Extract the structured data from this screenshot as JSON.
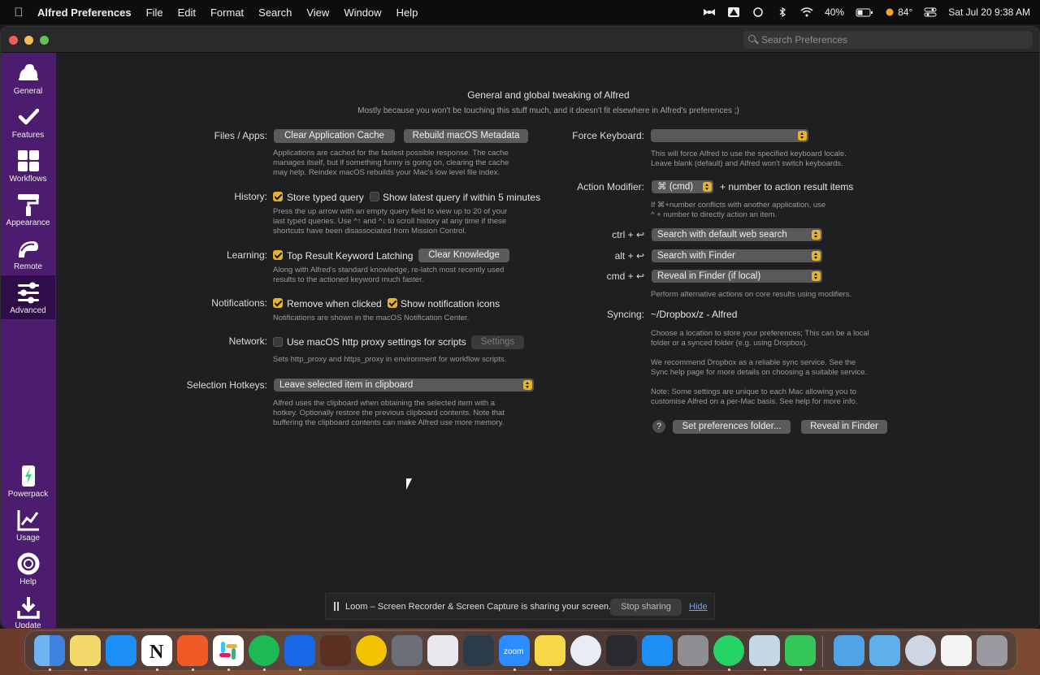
{
  "menubar": {
    "app_name": "Alfred Preferences",
    "items": [
      "File",
      "Edit",
      "Format",
      "Search",
      "View",
      "Window",
      "Help"
    ],
    "battery": "40%",
    "weather": "84°",
    "clock": "Sat Jul 20  9:38 AM"
  },
  "window": {
    "search_placeholder": "Search Preferences"
  },
  "sidebar": {
    "top": [
      {
        "label": "General",
        "icon": "alfred-hat-icon",
        "active": false
      },
      {
        "label": "Features",
        "icon": "checkmark-icon",
        "active": false
      },
      {
        "label": "Workflows",
        "icon": "grid-icon",
        "active": false
      },
      {
        "label": "Appearance",
        "icon": "paint-roller-icon",
        "active": false
      },
      {
        "label": "Remote",
        "icon": "remote-icon",
        "active": false
      },
      {
        "label": "Advanced",
        "icon": "sliders-icon",
        "active": true
      }
    ],
    "bottom": [
      {
        "label": "Powerpack",
        "icon": "powerpack-icon"
      },
      {
        "label": "Usage",
        "icon": "chart-icon"
      },
      {
        "label": "Help",
        "icon": "lifebuoy-icon"
      },
      {
        "label": "Update",
        "icon": "download-icon"
      }
    ]
  },
  "header": {
    "title": "General and global tweaking of Alfred",
    "subtitle": "Mostly because you won't be touching this stuff much, and it doesn't fit elsewhere in Alfred's preferences ;)"
  },
  "left": {
    "files": {
      "label": "Files / Apps:",
      "clear_cache": "Clear Application Cache",
      "rebuild": "Rebuild macOS Metadata",
      "desc": [
        "Applications are cached for the fastest possible response. The cache",
        "manages itself, but if something funny is going on, clearing the cache",
        "may help. Reindex macOS rebuilds your Mac's low level file index."
      ]
    },
    "history": {
      "label": "History:",
      "store": "Store typed query",
      "show_latest": "Show latest query if within 5 minutes",
      "desc": [
        "Press the up arrow with an empty query field to view up to 20 of your",
        "last typed queries. Use ^↑ and ^↓ to scroll history at any time if these",
        "shortcuts have been disassociated from Mission Control."
      ]
    },
    "learning": {
      "label": "Learning:",
      "latching": "Top Result Keyword Latching",
      "clear_knowledge": "Clear Knowledge",
      "desc": [
        "Along with Alfred's standard knowledge, re-latch most recently used",
        "results to the actioned keyword much faster."
      ]
    },
    "notifications": {
      "label": "Notifications:",
      "remove": "Remove when clicked",
      "show_icons": "Show notification icons",
      "desc": "Notifications are shown in the macOS Notification Center."
    },
    "network": {
      "label": "Network:",
      "proxy": "Use macOS http proxy settings for scripts",
      "settings_btn": "Settings",
      "desc": "Sets http_proxy and https_proxy in environment for workflow scripts."
    },
    "hotkeys": {
      "label": "Selection Hotkeys:",
      "value": "Leave selected item in clipboard",
      "desc": [
        "Alfred uses the clipboard when obtaining the selected item with a",
        "hotkey. Optionally restore the previous clipboard contents. Note that",
        "buffering the clipboard contents can make Alfred use more memory."
      ]
    }
  },
  "right": {
    "force_keyboard": {
      "label": "Force Keyboard:",
      "value": "",
      "desc": [
        "This will force Alfred to use the specified keyboard locale.",
        "Leave blank (default) and Alfred won't switch keyboards."
      ]
    },
    "action_modifier": {
      "label": "Action Modifier:",
      "value": "⌘ (cmd)",
      "suffix": "+ number to action result items",
      "desc": [
        "If ⌘+number conflicts with another application, use",
        "^ + number to directly action an item."
      ]
    },
    "modifiers": {
      "ctrl_label": "ctrl + ↩",
      "ctrl_value": "Search with default web search",
      "alt_label": "alt + ↩",
      "alt_value": "Search with Finder",
      "cmd_label": "cmd + ↩",
      "cmd_value": "Reveal in Finder (if local)",
      "desc": "Perform alternative actions on core results using modifiers."
    },
    "syncing": {
      "label": "Syncing:",
      "value": "~/Dropbox/z - Alfred",
      "desc1": [
        "Choose a location to store your preferences; This can be a local",
        "folder or a synced folder (e.g. using Dropbox)."
      ],
      "desc2": [
        "We recommend Dropbox as a reliable sync service. See the",
        "Sync help page for more details on choosing a suitable service."
      ],
      "desc3": [
        "Note: Some settings are unique to each Mac allowing you to",
        "customise Alfred on a per-Mac basis. See help for more info."
      ],
      "help": "?",
      "set_folder": "Set preferences folder...",
      "reveal": "Reveal in Finder"
    }
  },
  "loom": {
    "message": "Loom – Screen Recorder & Screen Capture is sharing your screen.",
    "stop": "Stop sharing",
    "hide": "Hide"
  },
  "dock": {
    "apps": [
      "finder-icon",
      "notes-icon",
      "testflight-icon",
      "notion-icon",
      "brave-icon",
      "slack-icon",
      "spotify-icon",
      "tasks-icon",
      "camera-icon",
      "radiation-icon",
      "robot-icon",
      "pinwheel-icon",
      "claquette-icon",
      "zoom-icon",
      "notes2-icon",
      "1password-icon",
      "monitor-icon",
      "app-store-icon",
      "system-settings-icon",
      "whatsapp-icon",
      "preview-icon",
      "messages-icon",
      "folder-icon",
      "downloads-icon",
      "1password-mini-icon",
      "document-icon",
      "trash-icon"
    ],
    "zoom_label": "zoom"
  }
}
